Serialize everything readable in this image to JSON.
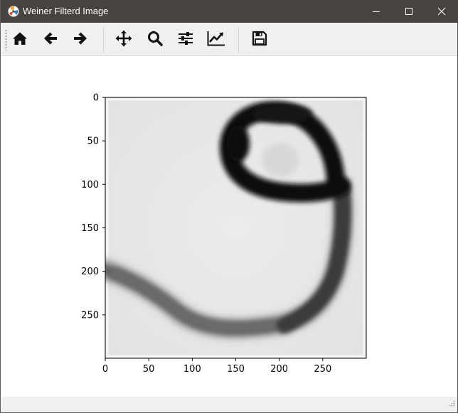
{
  "window": {
    "title": "Weiner Filterd Image"
  },
  "titlebar_buttons": {
    "minimize_icon": "minimize-icon",
    "maximize_icon": "maximize-icon",
    "close_icon": "close-icon"
  },
  "toolbar": {
    "tools": [
      {
        "name": "home",
        "icon": "home-icon"
      },
      {
        "name": "back",
        "icon": "arrow-left-icon"
      },
      {
        "name": "forward",
        "icon": "arrow-right-icon"
      },
      {
        "name": "pan",
        "icon": "move-icon"
      },
      {
        "name": "zoom",
        "icon": "zoom-icon"
      },
      {
        "name": "configure-subplots",
        "icon": "sliders-icon"
      },
      {
        "name": "edit-axes",
        "icon": "line-chart-icon"
      },
      {
        "name": "save",
        "icon": "save-icon"
      }
    ]
  },
  "chart_data": {
    "type": "heatmap",
    "colormap": "gray_r",
    "title": "",
    "xlabel": "",
    "ylabel": "",
    "xlim": [
      0,
      300
    ],
    "ylim": [
      300,
      0
    ],
    "x_ticks": [
      0,
      50,
      100,
      150,
      200,
      250
    ],
    "y_ticks": [
      0,
      50,
      100,
      150,
      200,
      250
    ],
    "x_tick_labels": [
      "0",
      "50",
      "100",
      "150",
      "200",
      "250"
    ],
    "y_tick_labels": [
      "0",
      "50",
      "100",
      "150",
      "200",
      "250"
    ],
    "grid": false
  },
  "colors": {
    "titlebar_bg": "#474340",
    "toolbar_bg": "#f0f0f0",
    "canvas_bg": "#ffffff",
    "image_background": "#e6e6e6",
    "stroke_dark": "#151515",
    "stroke_medium": "#454545"
  }
}
